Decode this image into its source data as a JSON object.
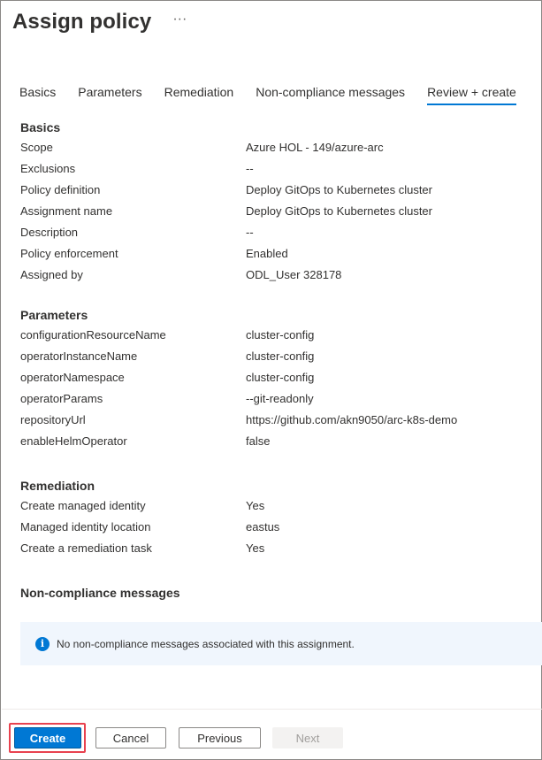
{
  "header": {
    "title": "Assign policy",
    "more_label": "···"
  },
  "tabs": [
    {
      "label": "Basics",
      "active": false
    },
    {
      "label": "Parameters",
      "active": false
    },
    {
      "label": "Remediation",
      "active": false
    },
    {
      "label": "Non-compliance messages",
      "active": false
    },
    {
      "label": "Review + create",
      "active": true
    }
  ],
  "basics": {
    "title": "Basics",
    "rows": [
      {
        "key": "Scope",
        "value": "Azure HOL - 149/azure-arc"
      },
      {
        "key": "Exclusions",
        "value": "--"
      },
      {
        "key": "Policy definition",
        "value": "Deploy GitOps to Kubernetes cluster"
      },
      {
        "key": "Assignment name",
        "value": "Deploy GitOps to Kubernetes cluster"
      },
      {
        "key": "Description",
        "value": "--"
      },
      {
        "key": "Policy enforcement",
        "value": "Enabled"
      },
      {
        "key": "Assigned by",
        "value": "ODL_User 328178"
      }
    ]
  },
  "parameters": {
    "title": "Parameters",
    "rows": [
      {
        "key": "configurationResourceName",
        "value": "cluster-config"
      },
      {
        "key": "operatorInstanceName",
        "value": "cluster-config"
      },
      {
        "key": "operatorNamespace",
        "value": "cluster-config"
      },
      {
        "key": "operatorParams",
        "value": "--git-readonly"
      },
      {
        "key": "repositoryUrl",
        "value": "https://github.com/akn9050/arc-k8s-demo"
      },
      {
        "key": "enableHelmOperator",
        "value": "false"
      }
    ]
  },
  "remediation": {
    "title": "Remediation",
    "rows": [
      {
        "key": "Create managed identity",
        "value": "Yes"
      },
      {
        "key": "Managed identity location",
        "value": "eastus"
      },
      {
        "key": "Create a remediation task",
        "value": "Yes"
      }
    ]
  },
  "noncompliance": {
    "title": "Non-compliance messages",
    "info_icon": "info-icon",
    "info_text": "No non-compliance messages associated with this assignment."
  },
  "footer": {
    "create_label": "Create",
    "cancel_label": "Cancel",
    "previous_label": "Previous",
    "next_label": "Next"
  },
  "colors": {
    "accent": "#0078d4",
    "highlight_outline": "#e8424f",
    "info_bg": "#f0f6fd"
  }
}
